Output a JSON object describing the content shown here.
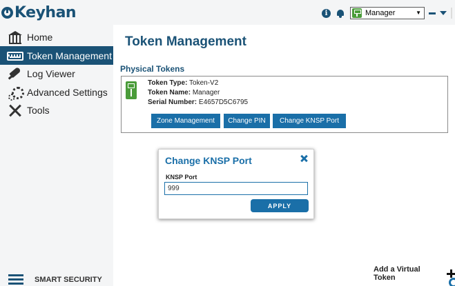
{
  "app": {
    "brand": "Keyhan",
    "footer_label": "SMART SECURITY"
  },
  "colors": {
    "primary": "#1a5276",
    "button": "#1a6fa8",
    "usb_green": "#4a9c3a",
    "sidebar_bg": "#f4f5f6"
  },
  "topbar": {
    "info_icon_glyph": "i",
    "selected_token": "Manager",
    "icons": [
      "info-icon",
      "bell-icon",
      "usb-token-icon",
      "minimize-icon",
      "caret-down-icon"
    ]
  },
  "sidebar": {
    "items": [
      {
        "label": "Home",
        "icon": "bank-icon",
        "active": false
      },
      {
        "label": "Token Management",
        "icon": "keyboard-icon",
        "active": true
      },
      {
        "label": "Log Viewer",
        "icon": "pen-icon",
        "active": false
      },
      {
        "label": "Advanced Settings",
        "icon": "gears-icon",
        "active": false
      },
      {
        "label": "Tools",
        "icon": "tools-icon",
        "active": false
      }
    ]
  },
  "main": {
    "title": "Token Management",
    "section_title": "Physical Tokens",
    "token": {
      "type_label": "Token Type:",
      "type_value": "Token-V2",
      "name_label": "Token Name:",
      "name_value": "Manager",
      "serial_label": "Serial Number:",
      "serial_value": "E4657D5C6795"
    },
    "buttons": {
      "zone": "Zone Management",
      "pin": "Change PIN",
      "knsp": "Change KNSP Port"
    },
    "add_virtual_label": "Add a Virtual Token"
  },
  "dialog": {
    "title": "Change KNSP Port",
    "field_label": "KNSP Port",
    "field_value": "999",
    "apply_label": "APPLY"
  }
}
